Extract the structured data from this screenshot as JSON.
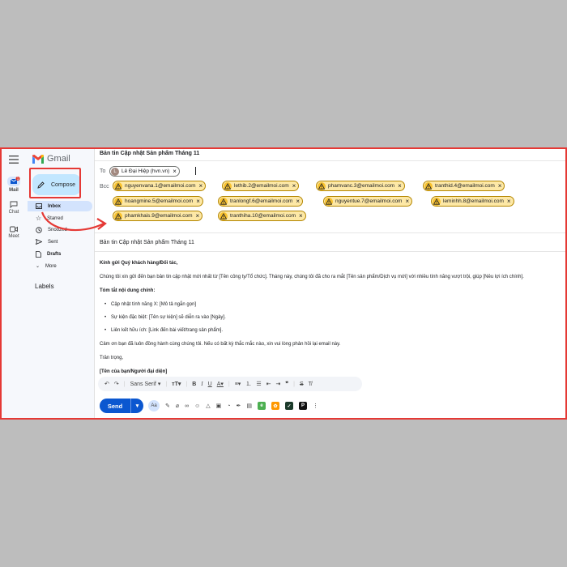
{
  "app": {
    "name": "Gmail"
  },
  "rail": {
    "mail": "Mail",
    "chat": "Chat",
    "meet": "Meet",
    "mail_badge": "1"
  },
  "sidebar": {
    "compose": "Compose",
    "items": [
      {
        "label": "Inbox"
      },
      {
        "label": "Starred"
      },
      {
        "label": "Snoozed"
      },
      {
        "label": "Sent"
      },
      {
        "label": "Drafts"
      },
      {
        "label": "More"
      }
    ],
    "labels_title": "Labels"
  },
  "compose": {
    "window_title": "Bản tin Cập nhật Sản phẩm Tháng 11",
    "to_label": "To",
    "to_chip": {
      "initial": "L",
      "text": "Lê Đại Hiệp (hvn.vn)"
    },
    "bcc_label": "Bcc",
    "bcc": [
      "nguyenvana.1@emailmoi.com",
      "lethib.2@emailmoi.com",
      "phamvanc.3@emailmoi.com",
      "tranthid.4@emailmoi.com",
      "hoangmine.5@emailmoi.com",
      "tranlongf.6@emailmoi.com",
      "nguyentue.7@emailmoi.com",
      "leminhh.8@emailmoi.com",
      "phamkhais.9@emailmoi.com",
      "tranthiha.10@emailmoi.com"
    ],
    "subject": "Bản tin Cập nhật Sản phẩm Tháng 11",
    "body": {
      "greeting": "Kính gửi Quý khách hàng/Đối tác,",
      "intro": "Chúng tôi xin gửi đến bạn bản tin cập nhật mới nhất từ [Tên công ty/Tổ chức]. Tháng này, chúng tôi đã cho ra mắt [Tên sản phẩm/Dịch vụ mới] với nhiều tính năng vượt trội, giúp [Nêu lợi ích chính].",
      "summary_title": "Tóm tắt nội dung chính:",
      "bullets": [
        "Cập nhật tính năng X: [Mô tả ngắn gọn]",
        "Sự kiện đặc biệt: [Tên sự kiện] sẽ diễn ra vào [Ngày].",
        "Liên kết hữu ích: [Link đến bài viết/trang sản phẩm]."
      ],
      "thanks": "Cảm ơn bạn đã luôn đồng hành cùng chúng tôi. Nếu có bất kỳ thắc mắc nào, xin vui lòng phản hồi lại email này.",
      "closing": "Trân trọng,",
      "signature": "[Tên của bạn/Người đại diện]"
    },
    "toolbar": {
      "font": "Sans Serif",
      "send": "Send"
    }
  }
}
